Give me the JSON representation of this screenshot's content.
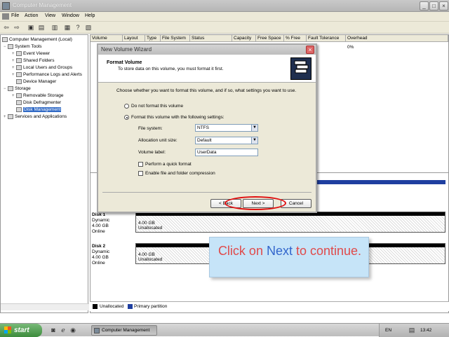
{
  "window": {
    "title": "Computer Management"
  },
  "menu": [
    "File",
    "Action",
    "View",
    "Window",
    "Help"
  ],
  "tree": [
    {
      "label": "Computer Management (Local)",
      "level": 0,
      "expander": "",
      "selected": false
    },
    {
      "label": "System Tools",
      "level": 1,
      "expander": "−",
      "selected": false
    },
    {
      "label": "Event Viewer",
      "level": 2,
      "expander": "+",
      "selected": false
    },
    {
      "label": "Shared Folders",
      "level": 2,
      "expander": "+",
      "selected": false
    },
    {
      "label": "Local Users and Groups",
      "level": 2,
      "expander": "+",
      "selected": false
    },
    {
      "label": "Performance Logs and Alerts",
      "level": 2,
      "expander": "+",
      "selected": false
    },
    {
      "label": "Device Manager",
      "level": 2,
      "expander": "",
      "selected": false
    },
    {
      "label": "Storage",
      "level": 1,
      "expander": "−",
      "selected": false
    },
    {
      "label": "Removable Storage",
      "level": 2,
      "expander": "+",
      "selected": false
    },
    {
      "label": "Disk Defragmenter",
      "level": 2,
      "expander": "",
      "selected": false
    },
    {
      "label": "Disk Management",
      "level": 2,
      "expander": "",
      "selected": true
    },
    {
      "label": "Services and Applications",
      "level": 1,
      "expander": "+",
      "selected": false
    }
  ],
  "columns": [
    "Volume",
    "Layout",
    "Type",
    "File System",
    "Status",
    "Capacity",
    "Free Space",
    "% Free",
    "Fault Tolerance",
    "Overhead"
  ],
  "overhead_value": "0%",
  "disks": [
    {
      "name": "Disk 1",
      "type": "Dynamic",
      "size": "4.00 GB",
      "status": "Online",
      "part_size": "4.00 GB",
      "part_state": "Unallocated"
    },
    {
      "name": "Disk 2",
      "type": "Dynamic",
      "size": "4.00 GB",
      "status": "Online",
      "part_size": "4.00 GB",
      "part_state": "Unallocated"
    }
  ],
  "legend": {
    "unallocated": "Unallocated",
    "primary": "Primary partition",
    "unallocated_color": "#000000",
    "primary_color": "#1f3fa0"
  },
  "dialog": {
    "title": "New Volume Wizard",
    "heading": "Format Volume",
    "subheading": "To store data on this volume, you must format it first.",
    "question": "Choose whether you want to format this volume, and if so, what settings you want to use.",
    "opt_no_format": "Do not format this volume",
    "opt_format": "Format this volume with the following settings:",
    "fs_label": "File system:",
    "fs_value": "NTFS",
    "alloc_label": "Allocation unit size:",
    "alloc_value": "Default",
    "vol_label": "Volume label:",
    "vol_value": "UserData",
    "quick_format": "Perform a quick format",
    "compression": "Enable file and folder compression",
    "back": "< Back",
    "next": "Next >",
    "cancel": "Cancel"
  },
  "callout": {
    "pre": "Click on ",
    "kw": "Next",
    "post": " to continue."
  },
  "taskbar": {
    "start": "start",
    "task": "Computer Management",
    "lang": "EN",
    "clock": "13:42"
  },
  "colors": {
    "highlight": "#e01010",
    "callout_bg": "#c6e4f8",
    "callout_text": "#e04a4a",
    "callout_keyword": "#3366cc"
  }
}
